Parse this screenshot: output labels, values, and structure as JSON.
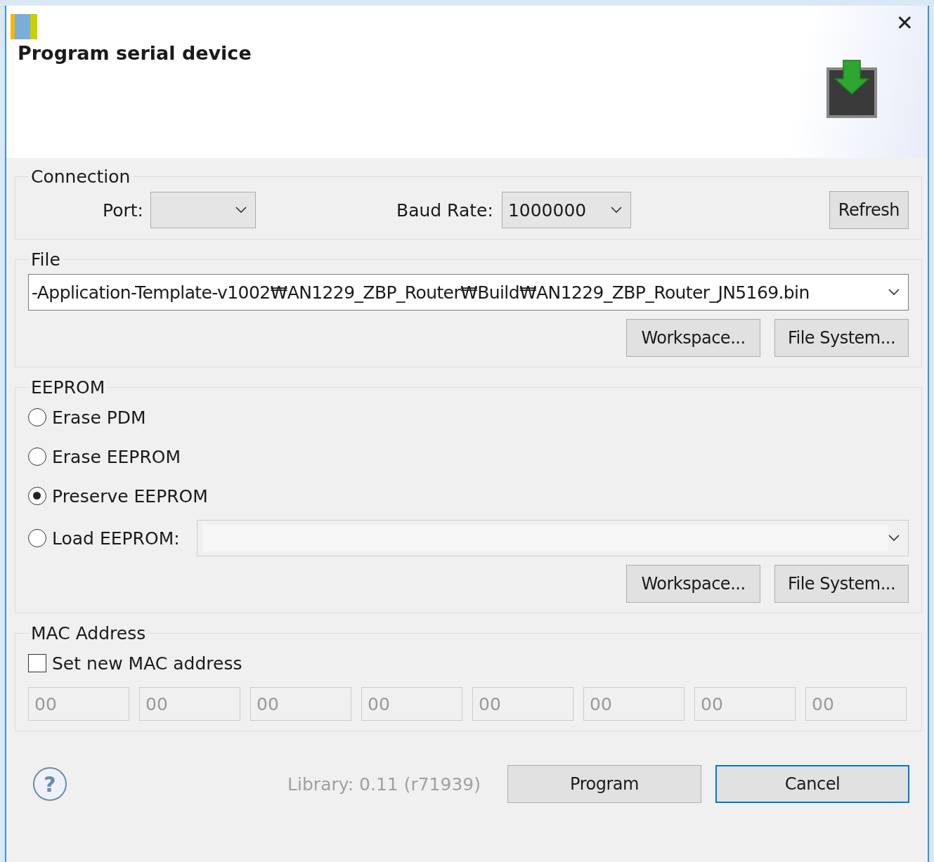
{
  "window": {
    "title": "Program serial device",
    "close": "✕"
  },
  "connection": {
    "legend": "Connection",
    "port": {
      "label": "Port:"
    },
    "baud": {
      "label": "Baud Rate:",
      "value": "1000000"
    },
    "refresh": "Refresh"
  },
  "file": {
    "legend": "File",
    "path": "-Application-Template-v1002₩AN1229_ZBP_Router₩Build₩AN1229_ZBP_Router_JN5169.bin",
    "buttons": [
      "Workspace...",
      "File System..."
    ]
  },
  "eeprom": {
    "legend": "EEPROM",
    "options": [
      {
        "kind": "radio",
        "label": "Erase PDM",
        "selected": false
      },
      {
        "kind": "radio",
        "label": "Erase EEPROM",
        "selected": false
      },
      {
        "kind": "radio",
        "label": "Preserve EEPROM",
        "selected": true
      },
      {
        "kind": "radio_file",
        "label": "Load EEPROM:",
        "selected": false,
        "disabled": true
      }
    ],
    "buttons": [
      "Workspace...",
      "File System..."
    ]
  },
  "mac": {
    "legend": "MAC Address",
    "set_new": {
      "label": "Set new MAC address",
      "checked": false
    },
    "disabled": true,
    "octets": [
      "00",
      "00",
      "00",
      "00",
      "00",
      "00",
      "00",
      "00"
    ]
  },
  "footer": {
    "help": "?",
    "library": "Library: 0.11 (r71939)",
    "buttons": [
      {
        "label": "Program",
        "default": false
      },
      {
        "label": "Cancel",
        "default": true
      }
    ]
  }
}
